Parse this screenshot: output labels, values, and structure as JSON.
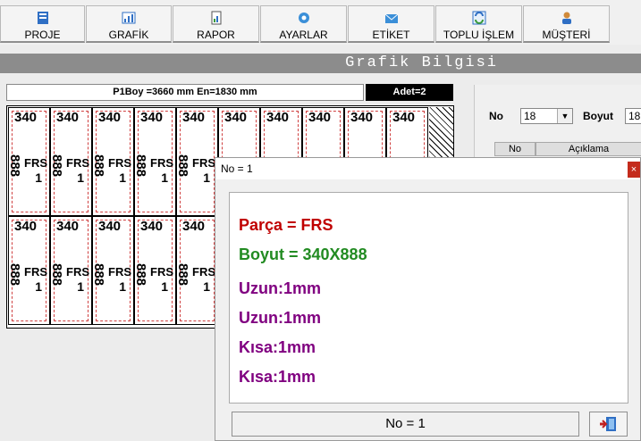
{
  "toolbar": {
    "buttons": [
      {
        "label": "PROJE",
        "icon": "proje-icon"
      },
      {
        "label": "GRAFİK",
        "icon": "chart-icon"
      },
      {
        "label": "RAPOR",
        "icon": "report-icon"
      },
      {
        "label": "AYARLAR",
        "icon": "gear-icon"
      },
      {
        "label": "ETİKET",
        "icon": "label-icon"
      },
      {
        "label": "TOPLU İŞLEM",
        "icon": "batch-icon"
      },
      {
        "label": "MÜŞTERİ",
        "icon": "user-icon"
      }
    ]
  },
  "window": {
    "title": "Grafik Bilgisi"
  },
  "board": {
    "info": "P1Boy  =3660 mm  En=1830 mm",
    "count": "Adet=2",
    "piece": {
      "width": "340",
      "height": "888",
      "label": "FRS",
      "number": "1",
      "height_alt": "∞"
    }
  },
  "right_panel": {
    "no_label": "No",
    "no_value": "18",
    "boyut_label": "Boyut",
    "boyut_value": "18",
    "col_no": "No",
    "col_aciklama": "Açıklama"
  },
  "dialog": {
    "title": "No = 1",
    "close": "×",
    "lines": [
      "Parça = FRS",
      "Boyut = 340X888",
      "Uzun:1mm",
      "Uzun:1mm",
      "Kısa:1mm",
      "Kısa:1mm"
    ],
    "status": "No = 1"
  },
  "colors": {
    "parca": "#c00000",
    "boyut": "#228b22",
    "edge": "#800080",
    "title_bar": "#8c8c8c"
  }
}
